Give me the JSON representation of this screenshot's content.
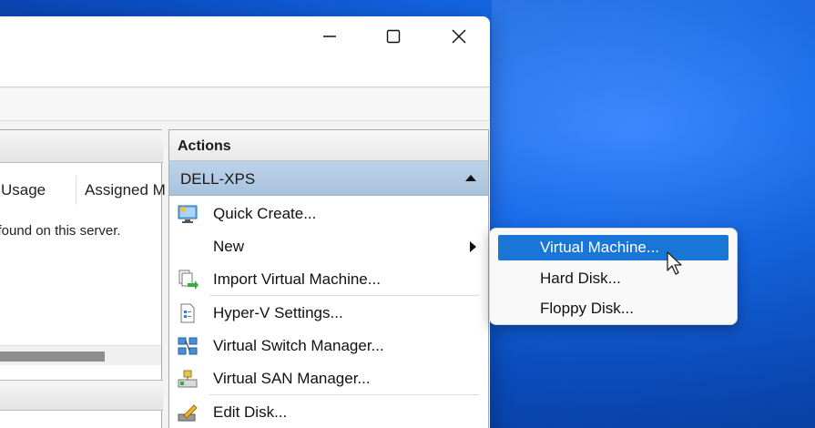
{
  "window": {
    "caption_buttons": [
      {
        "name": "minimize",
        "icon": "minimize-icon"
      },
      {
        "name": "maximize",
        "icon": "maximize-icon"
      },
      {
        "name": "close",
        "icon": "close-icon"
      }
    ]
  },
  "left_pane": {
    "columns": [
      "Usage",
      "Assigned M"
    ],
    "empty_message": "e found on this server."
  },
  "actions": {
    "header": "Actions",
    "server": "DELL-XPS",
    "items": [
      {
        "label": "Quick Create...",
        "icon": "quick-create-icon"
      },
      {
        "label": "New",
        "icon": "",
        "has_submenu": true
      },
      {
        "label": "Import Virtual Machine...",
        "icon": "import-vm-icon"
      },
      {
        "label": "Hyper-V Settings...",
        "icon": "hyperv-settings-icon"
      },
      {
        "label": "Virtual Switch Manager...",
        "icon": "virtual-switch-icon"
      },
      {
        "label": "Virtual SAN Manager...",
        "icon": "virtual-san-icon"
      },
      {
        "label": "Edit Disk...",
        "icon": "edit-disk-icon"
      }
    ]
  },
  "new_submenu": {
    "items": [
      {
        "label": "Virtual Machine...",
        "highlighted": true
      },
      {
        "label": "Hard Disk..."
      },
      {
        "label": "Floppy Disk..."
      }
    ]
  },
  "colors": {
    "highlight": "#1976d7",
    "server_row": "#bcd2e8",
    "desktop": "#1668e6"
  }
}
